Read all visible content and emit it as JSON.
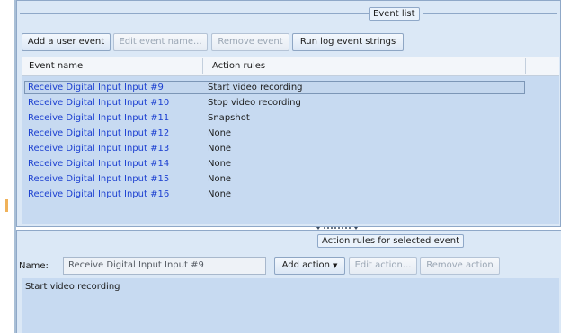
{
  "event_list": {
    "caption": "Event list",
    "toolbar": {
      "add": "Add a user event",
      "edit": "Edit event name...",
      "remove": "Remove event",
      "runlog": "Run log event strings"
    },
    "columns": [
      "Event name",
      "Action rules"
    ],
    "rows": [
      {
        "event": "Receive Digital Input Input  #9",
        "action": "Start video recording"
      },
      {
        "event": "Receive Digital Input Input  #10",
        "action": "Stop video recording"
      },
      {
        "event": "Receive Digital Input Input  #11",
        "action": "Snapshot"
      },
      {
        "event": "Receive Digital Input Input  #12",
        "action": "None"
      },
      {
        "event": "Receive Digital Input Input  #13",
        "action": "None"
      },
      {
        "event": "Receive Digital Input Input  #14",
        "action": "None"
      },
      {
        "event": "Receive Digital Input Input  #15",
        "action": "None"
      },
      {
        "event": "Receive Digital Input Input  #16",
        "action": "None"
      }
    ],
    "selected_index": 0
  },
  "action_rules": {
    "caption": "Action rules for selected event",
    "name_label": "Name:",
    "name_value": "Receive Digital Input  Input  #9",
    "add": "Add action",
    "edit": "Edit action...",
    "remove": "Remove action",
    "rules_text": "Start video recording"
  },
  "colors": {
    "panel": "#dbe8f6",
    "list_bg": "#c7daf1",
    "event_link": "#1b3fd0",
    "border": "#8fa8c8"
  }
}
